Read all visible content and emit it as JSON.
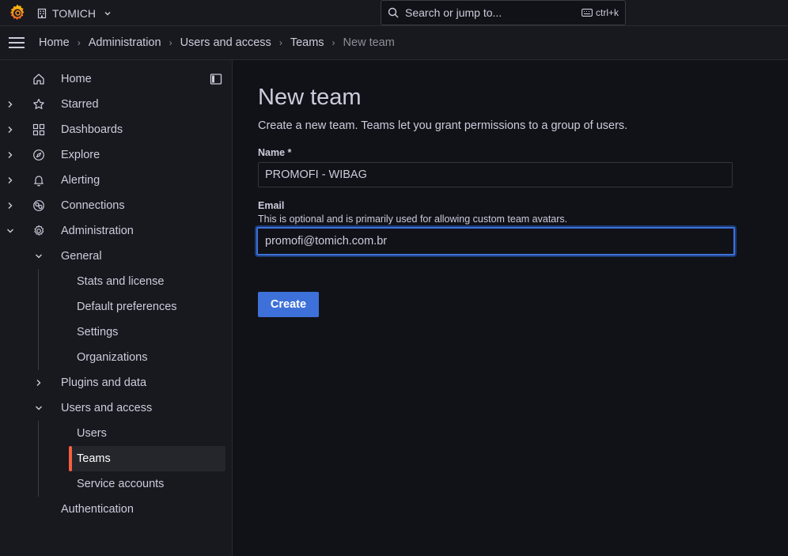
{
  "topbar": {
    "org_name": "TOMICH",
    "search_placeholder": "Search or jump to...",
    "search_shortcut": "ctrl+k"
  },
  "breadcrumbs": [
    {
      "label": "Home"
    },
    {
      "label": "Administration"
    },
    {
      "label": "Users and access"
    },
    {
      "label": "Teams"
    },
    {
      "label": "New team"
    }
  ],
  "sidebar": {
    "items": [
      {
        "label": "Home",
        "icon": "home-icon"
      },
      {
        "label": "Starred",
        "icon": "star-icon"
      },
      {
        "label": "Dashboards",
        "icon": "dashboards-icon"
      },
      {
        "label": "Explore",
        "icon": "compass-icon"
      },
      {
        "label": "Alerting",
        "icon": "bell-icon"
      },
      {
        "label": "Connections",
        "icon": "connections-icon"
      },
      {
        "label": "Administration",
        "icon": "gear-icon"
      },
      {
        "label": "General"
      },
      {
        "label": "Stats and license"
      },
      {
        "label": "Default preferences"
      },
      {
        "label": "Settings"
      },
      {
        "label": "Organizations"
      },
      {
        "label": "Plugins and data"
      },
      {
        "label": "Users and access"
      },
      {
        "label": "Users"
      },
      {
        "label": "Teams"
      },
      {
        "label": "Service accounts"
      },
      {
        "label": "Authentication"
      }
    ],
    "active_item": "Teams",
    "accent_color": "#f55f3e"
  },
  "main": {
    "title": "New team",
    "subtitle": "Create a new team. Teams let you grant permissions to a group of users.",
    "name_label": "Name *",
    "name_value": "PROMOFI - WIBAG",
    "email_label": "Email",
    "email_description": "This is optional and is primarily used for allowing custom team avatars.",
    "email_value": "promofi@tomich.com.br",
    "create_label": "Create",
    "primary_color": "#3d71d9"
  }
}
